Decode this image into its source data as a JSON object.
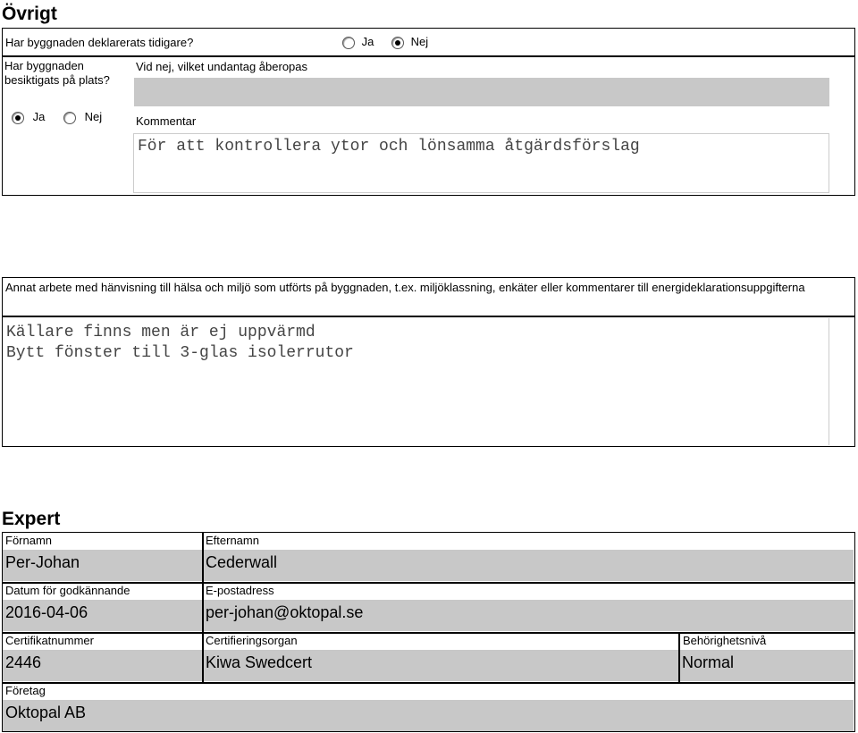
{
  "ovrigt": {
    "title": "Övrigt",
    "declared_question": "Har byggnaden deklarerats tidigare?",
    "declared_yes": "Ja",
    "declared_no": "Nej",
    "declared_selected": "Nej",
    "inspected_question": "Har byggnaden besiktigats på plats?",
    "exception_label": "Vid nej, vilket undantag åberopas",
    "exception_value": "",
    "inspected_yes": "Ja",
    "inspected_no": "Nej",
    "inspected_selected": "Ja",
    "comment_label": "Kommentar",
    "comment_value": "För att kontrollera ytor och lönsamma åtgärdsförslag"
  },
  "annat": {
    "label": "Annat arbete med hänvisning till hälsa och miljö som utförts på byggnaden, t.ex. miljöklassning, enkäter eller kommentarer till energideklarationsuppgifterna",
    "line1": "Källare finns men är ej uppvärmd",
    "line2": "Bytt fönster till 3-glas isolerrutor"
  },
  "expert": {
    "title": "Expert",
    "first_name_label": "Förnamn",
    "first_name": "Per-Johan",
    "last_name_label": "Efternamn",
    "last_name": "Cederwall",
    "approval_date_label": "Datum för godkännande",
    "approval_date": "2016-04-06",
    "email_label": "E-postadress",
    "email": "per-johan@oktopal.se",
    "cert_number_label": "Certifikatnummer",
    "cert_number": "2446",
    "cert_body_label": "Certifieringsorgan",
    "cert_body": "Kiwa Swedcert",
    "level_label": "Behörighetsnivå",
    "level": "Normal",
    "company_label": "Företag",
    "company": "Oktopal AB"
  }
}
